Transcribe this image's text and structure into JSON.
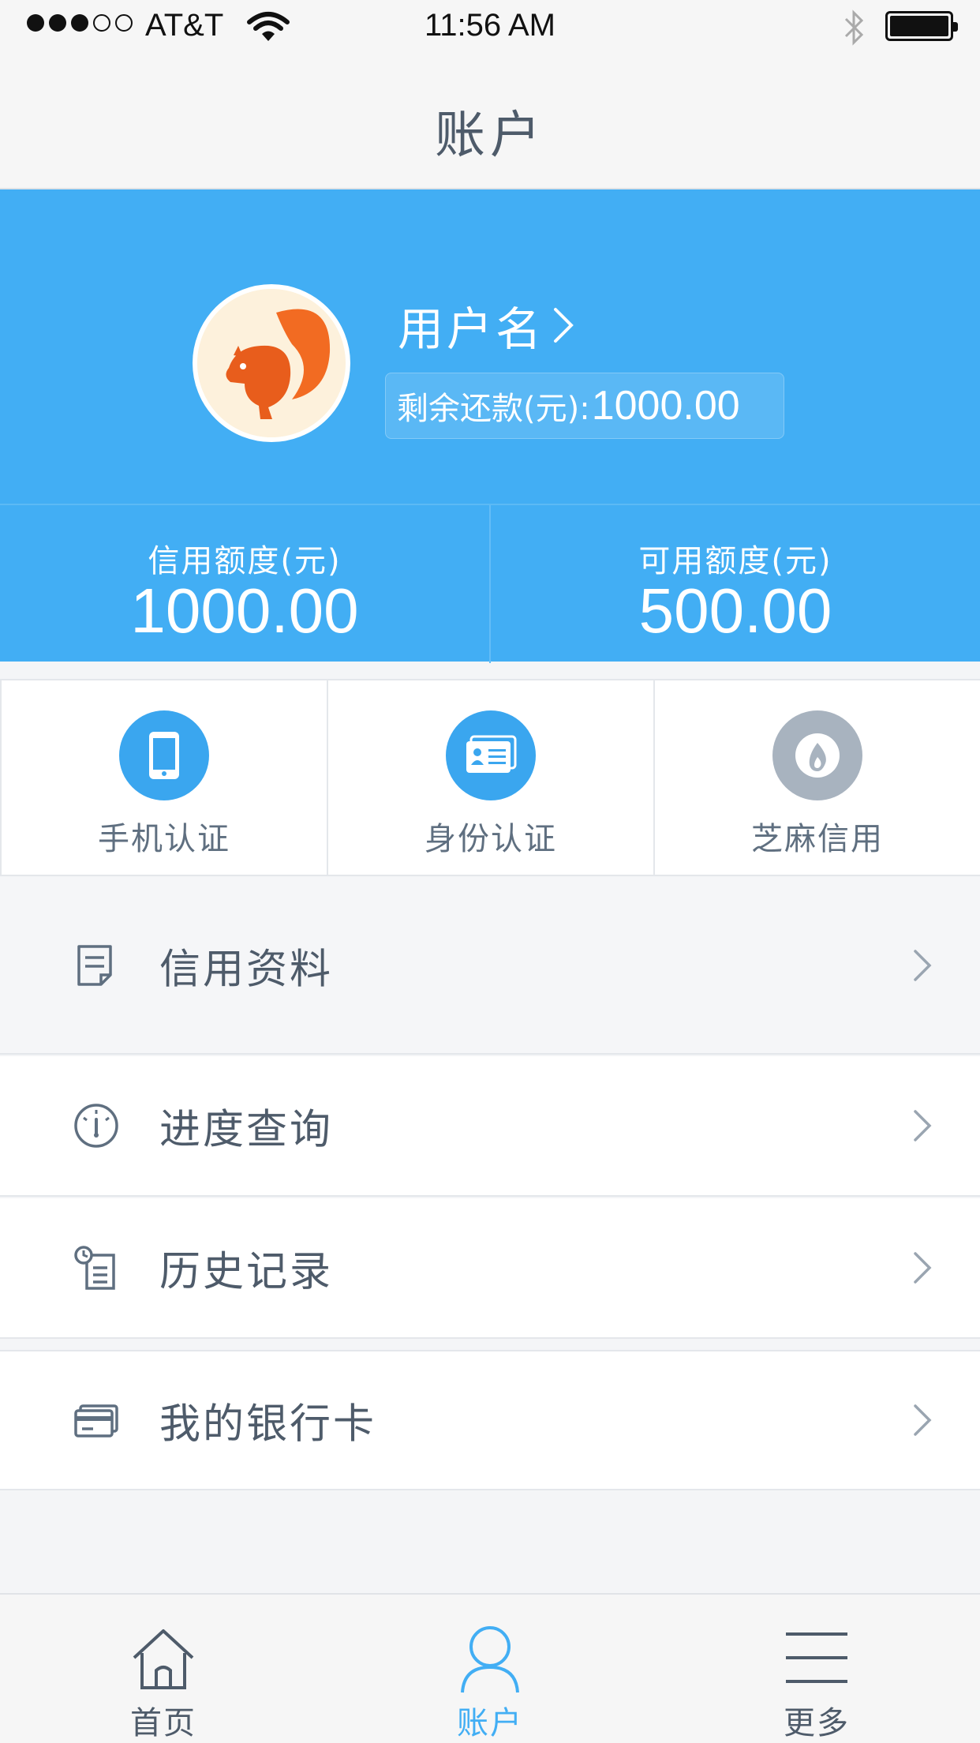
{
  "status_bar": {
    "carrier": "AT&T",
    "time": "11:56 AM"
  },
  "nav": {
    "title": "账户"
  },
  "profile": {
    "username": "用户名",
    "repay_label": "剩余还款(元):",
    "repay_value": "1000.00"
  },
  "quota": {
    "credit_label": "信用额度(元)",
    "credit_value": "1000.00",
    "available_label": "可用额度(元)",
    "available_value": "500.00"
  },
  "verify": [
    {
      "label": "手机认证",
      "icon": "phone-icon"
    },
    {
      "label": "身份认证",
      "icon": "id-card-icon"
    },
    {
      "label": "芝麻信用",
      "icon": "sesame-icon"
    }
  ],
  "menu": [
    {
      "label": "信用资料",
      "icon": "document-icon"
    },
    {
      "label": "进度查询",
      "icon": "gauge-icon"
    },
    {
      "label": "历史记录",
      "icon": "history-icon"
    },
    {
      "label": "我的银行卡",
      "icon": "bank-card-icon"
    }
  ],
  "tabs": [
    {
      "label": "首页",
      "icon": "home-icon",
      "active": false
    },
    {
      "label": "账户",
      "icon": "user-icon",
      "active": true
    },
    {
      "label": "更多",
      "icon": "menu-icon",
      "active": false
    }
  ],
  "colors": {
    "brand_blue": "#42aef4",
    "text": "#4e5b6a",
    "gray_icon": "#a8b3bf"
  }
}
